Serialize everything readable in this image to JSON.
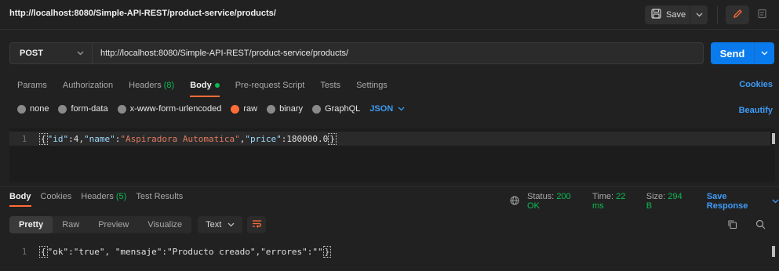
{
  "window": {
    "title": "http://localhost:8080/Simple-API-REST/product-service/products/",
    "save_label": "Save"
  },
  "request": {
    "method": "POST",
    "url": "http://localhost:8080/Simple-API-REST/product-service/products/",
    "send_label": "Send"
  },
  "request_tabs": {
    "params": "Params",
    "authorization": "Authorization",
    "headers_label": "Headers",
    "headers_count": "(8)",
    "body": "Body",
    "pre_request": "Pre-request Script",
    "tests": "Tests",
    "settings": "Settings",
    "cookies": "Cookies"
  },
  "body_types": {
    "none": "none",
    "form_data": "form-data",
    "urlencoded": "x-www-form-urlencoded",
    "raw": "raw",
    "binary": "binary",
    "graphql": "GraphQL",
    "format": "JSON",
    "beautify": "Beautify"
  },
  "request_body": {
    "line_number": "1",
    "brace_open": "{",
    "id_key": "\"id\"",
    "id_value": "4",
    "name_key": "\"name\"",
    "name_value": "\"Aspiradora Automatica\"",
    "price_key": "\"price\"",
    "price_value": "180000.0",
    "brace_close": "}"
  },
  "response_tabs": {
    "body": "Body",
    "cookies": "Cookies",
    "headers_label": "Headers",
    "headers_count": "(5)",
    "test_results": "Test Results"
  },
  "response_status": {
    "status_label": "Status:",
    "status_value": "200 OK",
    "time_label": "Time:",
    "time_value": "22 ms",
    "size_label": "Size:",
    "size_value": "294 B",
    "save_response": "Save Response"
  },
  "response_view": {
    "pretty": "Pretty",
    "raw": "Raw",
    "preview": "Preview",
    "visualize": "Visualize",
    "format": "Text"
  },
  "response_body": {
    "line_number": "1",
    "text": "\"ok\":\"true\", \"mensaje\":\"Producto creado\",\"errores\":\"\"",
    "brace_open": "{",
    "brace_close": "}"
  }
}
